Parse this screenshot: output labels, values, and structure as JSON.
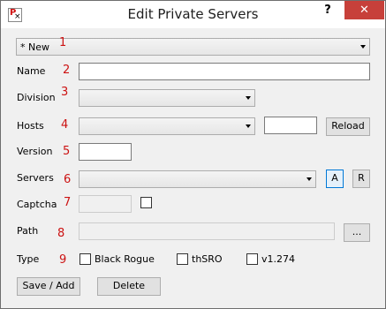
{
  "window": {
    "title": "Edit Private Servers",
    "help_label": "?",
    "close_label": "✕",
    "app_icon_glyph": "P"
  },
  "server_select": {
    "value": "* New",
    "number": "1"
  },
  "fields": {
    "name": {
      "label": "Name",
      "number": "2",
      "value": ""
    },
    "division": {
      "label": "Division",
      "number": "3",
      "value": ""
    },
    "hosts": {
      "label": "Hosts",
      "number": "4",
      "value": "",
      "extra_value": "",
      "reload_label": "Reload"
    },
    "version": {
      "label": "Version",
      "number": "5",
      "value": ""
    },
    "servers": {
      "label": "Servers",
      "number": "6",
      "value": "",
      "a_label": "A",
      "r_label": "R"
    },
    "captcha": {
      "label": "Captcha",
      "number": "7",
      "value": ""
    },
    "path": {
      "label": "Path",
      "number": "8",
      "value": "",
      "browse_label": "..."
    },
    "type": {
      "label": "Type",
      "number": "9",
      "options": [
        "Black Rogue",
        "thSRO",
        "v1.274"
      ]
    }
  },
  "actions": {
    "save_label": "Save / Add",
    "delete_label": "Delete"
  },
  "colors": {
    "number_red": "#cc1111",
    "close_red": "#c7403a",
    "focus_blue": "#0078d7"
  }
}
